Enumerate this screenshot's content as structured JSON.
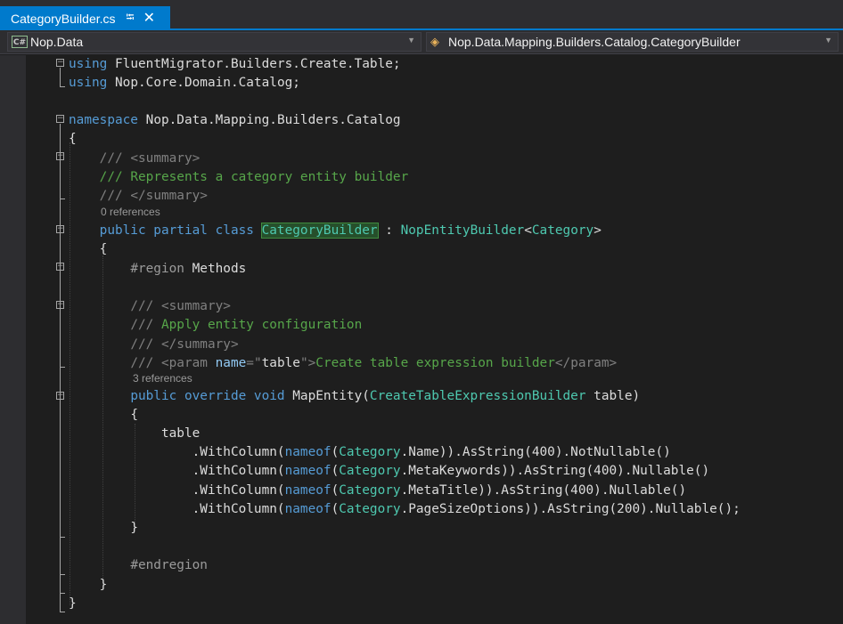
{
  "tab": {
    "title": "CategoryBuilder.cs",
    "pin_icon": "pin-icon",
    "close_icon": "close-icon"
  },
  "navbar": {
    "project_badge": "C#",
    "project": "Nop.Data",
    "type": "Nop.Data.Mapping.Builders.Catalog.CategoryBuilder"
  },
  "code": {
    "l1": [
      "using",
      "FluentMigrator.Builders.Create.Table;"
    ],
    "l2": [
      "using",
      "Nop.Core.Domain.Catalog;"
    ],
    "l4": [
      "namespace",
      "Nop.Data.Mapping.Builders.Catalog"
    ],
    "l5": "{",
    "l6": [
      "///",
      "<summary>"
    ],
    "l7": [
      "///",
      "Represents a category entity builder"
    ],
    "l8": [
      "///",
      "</summary>"
    ],
    "lens1": "0 references",
    "l9": [
      "public partial class",
      "CategoryBuilder",
      ":",
      "NopEntityBuilder",
      "<",
      "Category",
      ">"
    ],
    "l10": "{",
    "l11": [
      "#region",
      "Methods"
    ],
    "l13": [
      "///",
      "<summary>"
    ],
    "l14": [
      "///",
      "Apply entity configuration"
    ],
    "l15": [
      "///",
      "</summary>"
    ],
    "l16": [
      "///",
      "<param",
      "name",
      "=\"",
      "table",
      "\">",
      "Create table expression builder",
      "</param>"
    ],
    "lens2": "3 references",
    "l17": [
      "public override void",
      "MapEntity(",
      "CreateTableExpressionBuilder",
      "table)"
    ],
    "l18": "{",
    "l19": "table",
    "l20": [
      ".WithColumn(",
      "nameof",
      "(",
      "Category",
      ".Name)).AsString(400).NotNullable()"
    ],
    "l21": [
      ".WithColumn(",
      "nameof",
      "(",
      "Category",
      ".MetaKeywords)).AsString(400).Nullable()"
    ],
    "l22": [
      ".WithColumn(",
      "nameof",
      "(",
      "Category",
      ".MetaTitle)).AsString(400).Nullable()"
    ],
    "l23": [
      ".WithColumn(",
      "nameof",
      "(",
      "Category",
      ".PageSizeOptions)).AsString(200).Nullable();"
    ],
    "l24": "}",
    "l26": "#endregion",
    "l27": "}",
    "l28": "}"
  },
  "gutter": {
    "quick_action_icon": "screwdriver-icon",
    "fold_glyph": "−"
  },
  "colors": {
    "keyword": "#569cd6",
    "type": "#4ec9b0",
    "comment": "#57a64a",
    "tab_active": "#007acc",
    "editor_bg": "#1e1e1e"
  }
}
